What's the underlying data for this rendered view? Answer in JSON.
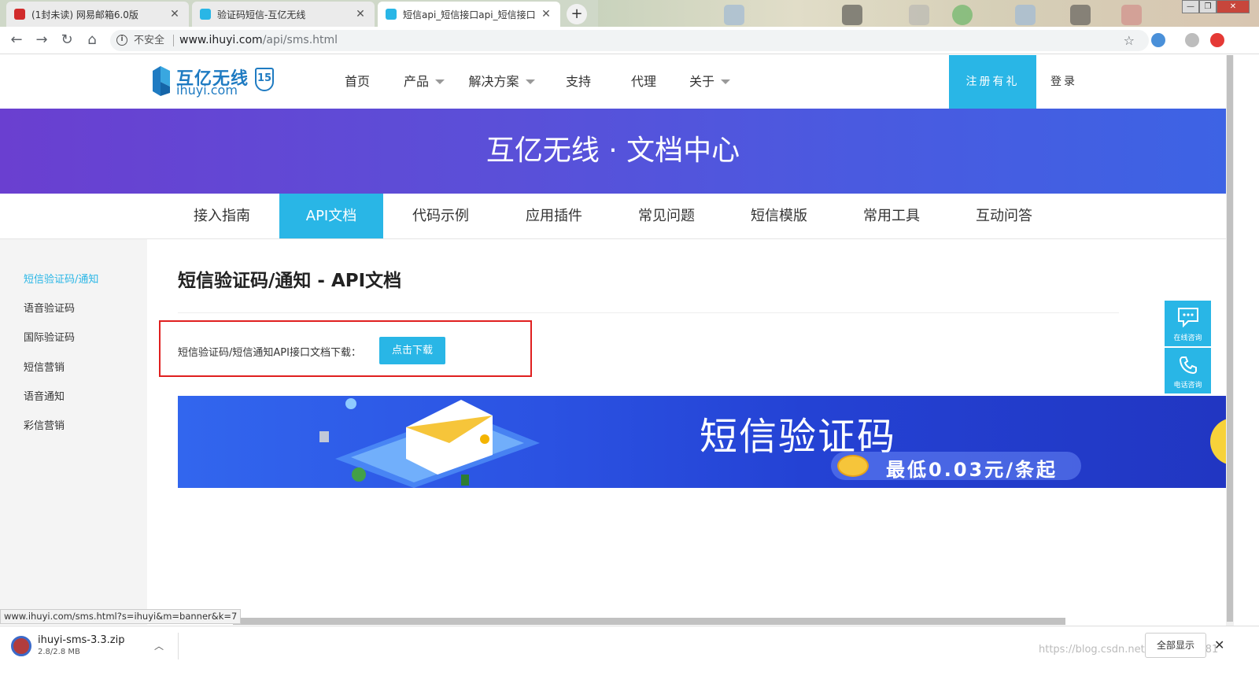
{
  "browser": {
    "tabs": [
      {
        "title": "(1封未读) 网易邮箱6.0版",
        "close": "✕",
        "favicon_color": "#d12b2b"
      },
      {
        "title": "验证码短信-互亿无线",
        "close": "✕",
        "favicon_color": "#29b6e6"
      },
      {
        "title": "短信api_短信接口api_短信接口",
        "close": "✕",
        "favicon_color": "#29b6e6"
      }
    ],
    "new_tab": "+",
    "window_controls": {
      "minimize": "—",
      "restore": "❐",
      "close": "✕"
    },
    "nav": {
      "back": "←",
      "forward": "→",
      "reload": "↻",
      "home": "⌂"
    },
    "address": {
      "security_label": "不安全",
      "domain": "www.ihuyi.com",
      "path": "/api/sms.html",
      "info_glyph": "i",
      "bookmark": "☆"
    }
  },
  "site": {
    "logo": {
      "cn": "互亿无线",
      "en": "ihuyi.com",
      "badge": "15"
    },
    "nav": [
      {
        "label": "首页",
        "dropdown": false
      },
      {
        "label": "产品",
        "dropdown": true
      },
      {
        "label": "解决方案",
        "dropdown": true
      },
      {
        "label": "支持",
        "dropdown": false
      },
      {
        "label": "代理",
        "dropdown": false
      },
      {
        "label": "关于",
        "dropdown": true
      }
    ],
    "register_label": "注册有礼",
    "login_label": "登录"
  },
  "hero": {
    "title": "互亿无线 · 文档中心"
  },
  "doc_tabs": {
    "items": [
      "接入指南",
      "API文档",
      "代码示例",
      "应用插件",
      "常见问题",
      "短信模版",
      "常用工具",
      "互动问答"
    ],
    "active": "API文档"
  },
  "sidebar": {
    "items": [
      "短信验证码/通知",
      "语音验证码",
      "国际验证码",
      "短信营销",
      "语音通知",
      "彩信营销"
    ],
    "active": "短信验证码/通知"
  },
  "content": {
    "title": "短信验证码/通知 - API文档",
    "download_label": "短信验证码/短信通知API接口文档下载：",
    "download_button": "点击下载"
  },
  "promo": {
    "headline": "短信验证码",
    "subline": "最低0.03元/条起"
  },
  "float_service": {
    "online": "在线咨询",
    "phone": "电话咨询"
  },
  "status_url": "www.ihuyi.com/sms.html?s=ihuyi&m=banner&k=7",
  "downloads": {
    "file_name": "ihuyi-sms-3.3.zip",
    "file_size": "2.8/2.8 MB",
    "show_all": "全部显示",
    "close": "✕",
    "chevron": "︿"
  },
  "watermark": "https://blog.csdn.net/qq_34214381",
  "colors": {
    "accent": "#29b6e6",
    "hero_start": "#6a3fd0",
    "hero_end": "#3d63e4",
    "highlight_border": "#e02020"
  }
}
